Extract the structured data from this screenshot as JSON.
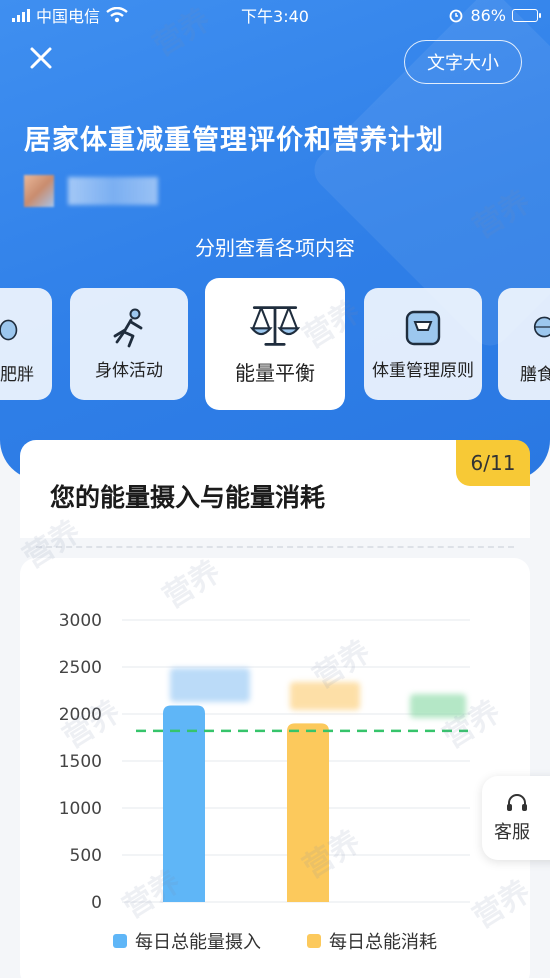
{
  "status_bar": {
    "carrier": "中国电信",
    "time": "下午3:40",
    "battery": "86%"
  },
  "header": {
    "font_size_button": "文字大小",
    "title": "居家体重减重管理评价和营养计划",
    "section_label": "分别查看各项内容"
  },
  "categories": [
    {
      "label": "肥胖",
      "icon": "body-icon"
    },
    {
      "label": "身体活动",
      "icon": "running-icon"
    },
    {
      "label": "能量平衡",
      "icon": "scale-balance-icon",
      "active": true
    },
    {
      "label": "体重管理原则",
      "icon": "weighing-scale-icon"
    },
    {
      "label": "膳食",
      "icon": "food-bowl-icon"
    }
  ],
  "card": {
    "title": "您的能量摄入与能量消耗",
    "page_indicator": "6/11"
  },
  "chart_data": {
    "type": "bar",
    "categories": [
      "每日总能量摄入",
      "每日总能消耗"
    ],
    "values": [
      2090,
      1900
    ],
    "reference_line": 1820,
    "ylim": [
      0,
      3000
    ],
    "yticks": [
      0,
      500,
      1000,
      1500,
      2000,
      2500,
      3000
    ],
    "colors": {
      "intake": "#5fb6f7",
      "expenditure": "#fcc95c",
      "reference": "#36c46b"
    },
    "grid": true,
    "legend": [
      "每日总能量摄入",
      "每日总能消耗"
    ]
  },
  "service": {
    "label": "客服",
    "icon": "headset-icon"
  },
  "watermark": "营养"
}
